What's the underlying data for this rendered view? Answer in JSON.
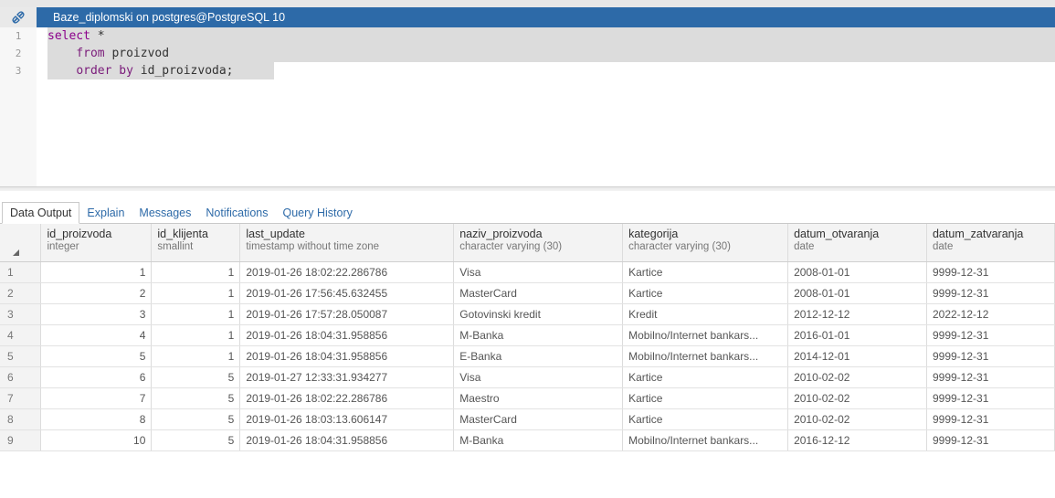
{
  "connection": {
    "title": "Baze_diplomski on postgres@PostgreSQL 10",
    "icon": "connection-icon"
  },
  "editor": {
    "line_numbers": [
      "1",
      "2",
      "3"
    ],
    "lines": [
      {
        "kw": "select",
        "rest": " *"
      },
      {
        "indent": "    ",
        "kw": "from",
        "rest": " proizvod"
      },
      {
        "indent": "    ",
        "kw": "order by",
        "rest": " id_proizvoda;"
      }
    ]
  },
  "tabs": [
    {
      "label": "Data Output",
      "active": true
    },
    {
      "label": "Explain",
      "active": false
    },
    {
      "label": "Messages",
      "active": false
    },
    {
      "label": "Notifications",
      "active": false
    },
    {
      "label": "Query History",
      "active": false
    }
  ],
  "grid": {
    "columns": [
      {
        "name": "id_proizvoda",
        "type": "integer"
      },
      {
        "name": "id_klijenta",
        "type": "smallint"
      },
      {
        "name": "last_update",
        "type": "timestamp without time zone"
      },
      {
        "name": "naziv_proizvoda",
        "type": "character varying (30)"
      },
      {
        "name": "kategorija",
        "type": "character varying (30)"
      },
      {
        "name": "datum_otvaranja",
        "type": "date"
      },
      {
        "name": "datum_zatvaranja",
        "type": "date"
      }
    ],
    "rows": [
      [
        "1",
        "1",
        "1",
        "2019-01-26 18:02:22.286786",
        "Visa",
        "Kartice",
        "2008-01-01",
        "9999-12-31"
      ],
      [
        "2",
        "2",
        "1",
        "2019-01-26 17:56:45.632455",
        "MasterCard",
        "Kartice",
        "2008-01-01",
        "9999-12-31"
      ],
      [
        "3",
        "3",
        "1",
        "2019-01-26 17:57:28.050087",
        "Gotovinski kredit",
        "Kredit",
        "2012-12-12",
        "2022-12-12"
      ],
      [
        "4",
        "4",
        "1",
        "2019-01-26 18:04:31.958856",
        "M-Banka",
        "Mobilno/Internet bankars...",
        "2016-01-01",
        "9999-12-31"
      ],
      [
        "5",
        "5",
        "1",
        "2019-01-26 18:04:31.958856",
        "E-Banka",
        "Mobilno/Internet bankars...",
        "2014-12-01",
        "9999-12-31"
      ],
      [
        "6",
        "6",
        "5",
        "2019-01-27 12:33:31.934277",
        "Visa",
        "Kartice",
        "2010-02-02",
        "9999-12-31"
      ],
      [
        "7",
        "7",
        "5",
        "2019-01-26 18:02:22.286786",
        "Maestro",
        "Kartice",
        "2010-02-02",
        "9999-12-31"
      ],
      [
        "8",
        "8",
        "5",
        "2019-01-26 18:03:13.606147",
        "MasterCard",
        "Kartice",
        "2010-02-02",
        "9999-12-31"
      ],
      [
        "9",
        "10",
        "5",
        "2019-01-26 18:04:31.958856",
        "M-Banka",
        "Mobilno/Internet bankars...",
        "2016-12-12",
        "9999-12-31"
      ]
    ]
  },
  "colors": {
    "title_bar": "#2d6aa8",
    "keyword": "#8b008b",
    "tab_link": "#2d6aa8"
  }
}
